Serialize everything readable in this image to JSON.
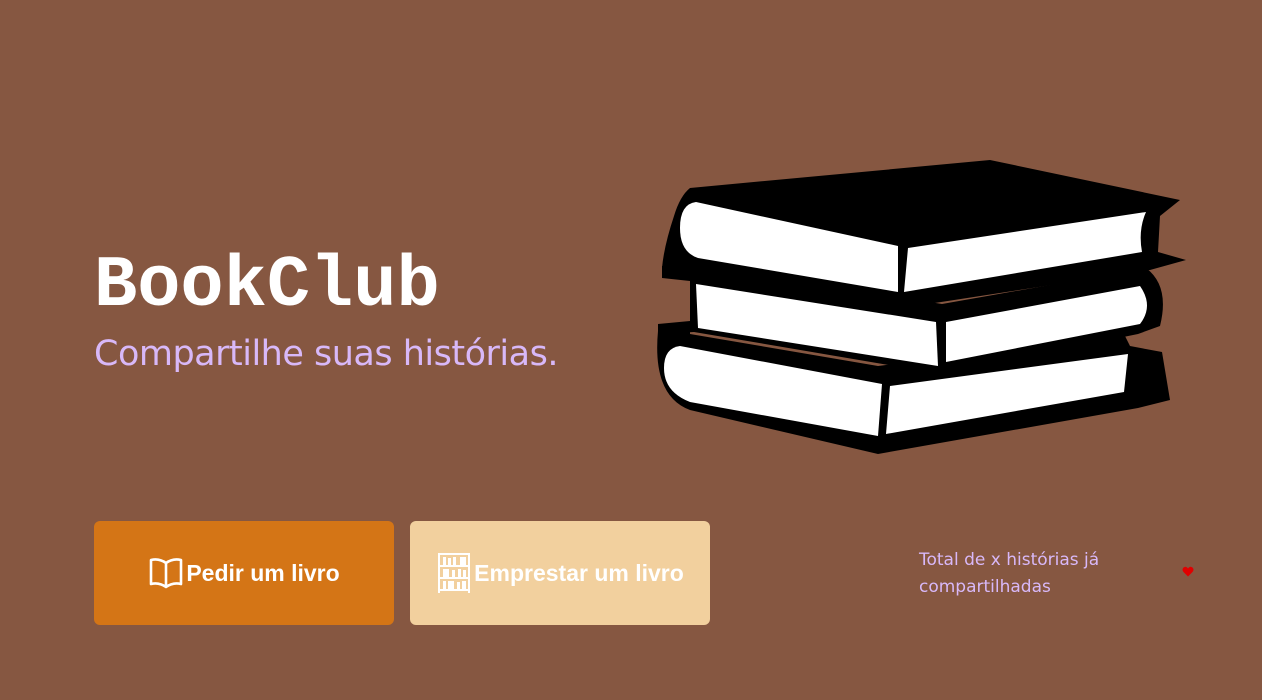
{
  "hero": {
    "title": "BookClub",
    "subtitle": "Compartilhe suas histórias.",
    "illustration_icon": "stack-of-books-icon"
  },
  "actions": {
    "request_label": "Pedir um livro",
    "request_icon": "open-book-icon",
    "lend_label": "Emprestar um livro",
    "lend_icon": "bookshelf-icon"
  },
  "stats": {
    "total_text": "Total de x histórias já compartilhadas",
    "heart_icon": "heart-icon"
  },
  "colors": {
    "background": "#865741",
    "title": "#ffffff",
    "subtitle": "#d8b8f8",
    "request_button": "#d47516",
    "lend_button": "#f2d09e",
    "heart": "#e00000"
  }
}
